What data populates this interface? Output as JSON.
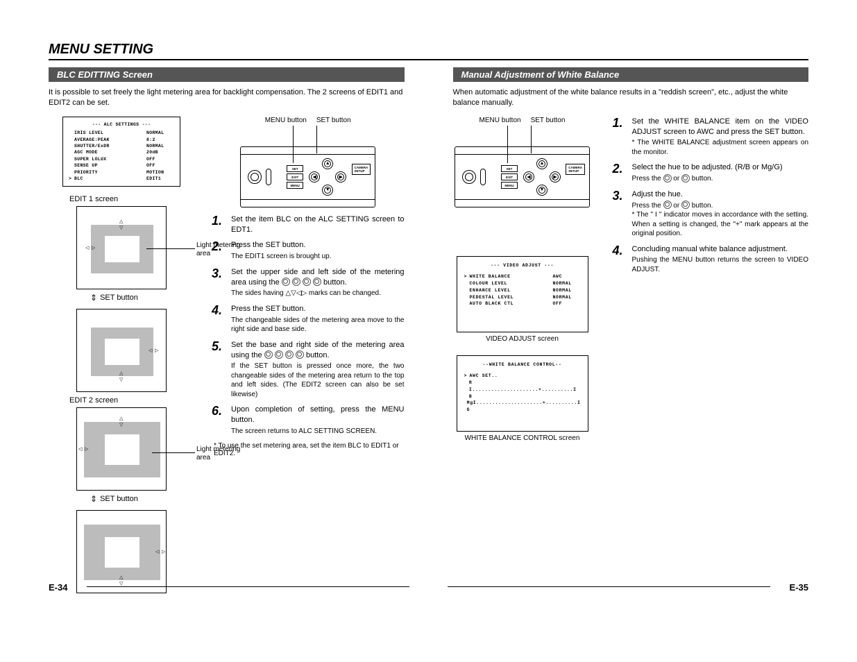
{
  "page_title": "MENU SETTING",
  "page_num_left": "E-34",
  "page_num_right": "E-35",
  "left": {
    "section_title": "BLC EDITTING Screen",
    "intro": "It is possible to set freely the light metering area for backlight compensation. The 2 screens of EDIT1 and EDIT2 can be set.",
    "alc_title": "--- ALC SETTINGS ---",
    "alc_rows": [
      {
        "label": "IRIS LEVEL",
        "val": "NORMAL"
      },
      {
        "label": "AVERAGE:PEAK",
        "val": "8:2"
      },
      {
        "label": "SHUTTER/ExDR",
        "val": "NORMAL"
      },
      {
        "label": "AGC MODE",
        "val": "20dB"
      },
      {
        "label": "SUPER LOLUX",
        "val": "OFF"
      },
      {
        "label": "SENSE UP",
        "val": "OFF"
      },
      {
        "label": "PRIORITY",
        "val": "MOTION"
      },
      {
        "label": "BLC",
        "val": "EDIT1",
        "cursor": ">"
      }
    ],
    "edit1_label": "EDIT 1 screen",
    "edit2_label": "EDIT 2 screen",
    "meter_label": "Light metering area",
    "set_button_label": "SET button",
    "menu_button_label": "MENU button",
    "camera_setup_label": "CAMERA\nSETUP",
    "ctrl_set": "SET",
    "ctrl_exit": "EXIT",
    "ctrl_menu": "MENU",
    "steps": [
      {
        "num": "1.",
        "main": "Set the item BLC on the ALC SETTING screen to EDT1."
      },
      {
        "num": "2.",
        "main": "Press the SET button.",
        "sub": "The EDIT1 screen is brought up."
      },
      {
        "num": "3.",
        "main": "Set the upper side and left side of the metering area using the ⊚ ⊚ ⊚ ⊚ button.",
        "sub": "The sides having △▽◁▷ marks can be changed."
      },
      {
        "num": "4.",
        "main": "Press the SET button.",
        "sub": "The changeable sides of the metering area move to the right side and base side."
      },
      {
        "num": "5.",
        "main": "Set the base and right side of the metering area using the ⊚ ⊚ ⊚ ⊚ button.",
        "sub": "If the SET button is pressed once more, the two changeable sides of the metering area return to the top and left sides. (The EDIT2 screen can also be set likewise)"
      },
      {
        "num": "6.",
        "main": "Upon completion of setting, press the MENU button.",
        "sub": "The screen returns to ALC SETTING SCREEN."
      }
    ],
    "footnote": "* To use the set metering area, set the item BLC to EDIT1 or EDIT2."
  },
  "right": {
    "section_title": "Manual Adjustment of White Balance",
    "intro": "When automatic adjustment of the white balance results in a \"reddish screen\", etc., adjust the white balance manually.",
    "menu_button_label": "MENU button",
    "set_button_label": "SET button",
    "video_adjust_title": "--- VIDEO ADJUST ---",
    "video_adjust_rows": [
      {
        "label": "WHITE BALANCE",
        "val": "AWC",
        "cursor": ">"
      },
      {
        "label": "COLOUR LEVEL",
        "val": "NORMAL"
      },
      {
        "label": "ENHANCE LEVEL",
        "val": "NORMAL"
      },
      {
        "label": "PEDESTAL LEVEL",
        "val": "NORMAL"
      },
      {
        "label": "AUTO BLACK CTL",
        "val": "OFF"
      }
    ],
    "video_adjust_caption": "VIDEO ADJUST screen",
    "wb_control_title": "--WHITE BALANCE CONTROL--",
    "wb_cursor": ">",
    "wb_awc": "AWC SET..",
    "wb_r_line": "R  I.....................+..........I  B",
    "wb_m_line": "MgI.....................+..........I  G",
    "wb_caption": "WHITE BALANCE CONTROL screen",
    "steps": [
      {
        "num": "1.",
        "main": "Set the WHITE BALANCE item on the VIDEO ADJUST screen to AWC and press the SET button.",
        "sub": "* The WHITE BALANCE adjustment screen appears on the monitor."
      },
      {
        "num": "2.",
        "main": "Select the hue to be adjusted. (R/B or Mg/G)",
        "sub": "Press the ⊚ or ⊚ button."
      },
      {
        "num": "3.",
        "main": "Adjust the hue.",
        "sub": "Press the ⊚ or ⊚ button.\n* The \" I \" indicator moves in accordance with the setting. When a setting is changed, the \"+\" mark appears at the original position."
      },
      {
        "num": "4.",
        "main": "Concluding manual white balance adjustment.",
        "sub": "Pushing the MENU button returns the screen to VIDEO ADJUST."
      }
    ]
  }
}
